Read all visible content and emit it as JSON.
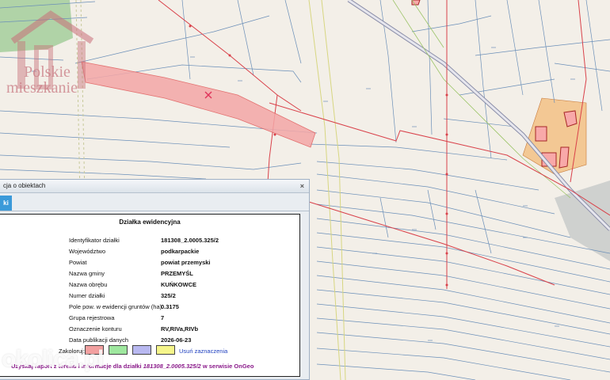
{
  "watermark": {
    "line1": "Polskie",
    "line2": "mieszkanie",
    "bottom": "okolica.pl"
  },
  "panel": {
    "title": "cja o obiektach",
    "close_label": "×",
    "tab_label": "ki",
    "card_title": "Działka ewidencyjna",
    "rows": [
      {
        "label": "Identyfikator działki",
        "value": "181308_2.0005.325/2"
      },
      {
        "label": "Województwo",
        "value": "podkarpackie"
      },
      {
        "label": "Powiat",
        "value": "powiat przemyski"
      },
      {
        "label": "Nazwa gminy",
        "value": "PRZEMYŚL"
      },
      {
        "label": "Nazwa obrębu",
        "value": "KUŃKOWCE"
      },
      {
        "label": "Numer działki",
        "value": "325/2"
      },
      {
        "label": "Pole pow. w ewidencji gruntów (ha)",
        "value": "0.3175"
      },
      {
        "label": "Grupa rejestrowa",
        "value": "7"
      },
      {
        "label": "Oznaczenie konturu",
        "value": "RV,RIVa,RIVb"
      },
      {
        "label": "Data publikacji danych",
        "value": "2026-06-23"
      }
    ],
    "color_label": "Zakoloruj:",
    "swatch_colors": [
      "#f2a0a0",
      "#9ee79e",
      "#b8b8f0",
      "#f5f58a"
    ],
    "clear_label": "Usuń zaznaczenia",
    "ongeo_prefix": "Uzyskaj raport z terenu i informacje dla działki",
    "ongeo_id": "181308_2.0005.325/2",
    "ongeo_suffix": "w serwisie OnGeo"
  }
}
